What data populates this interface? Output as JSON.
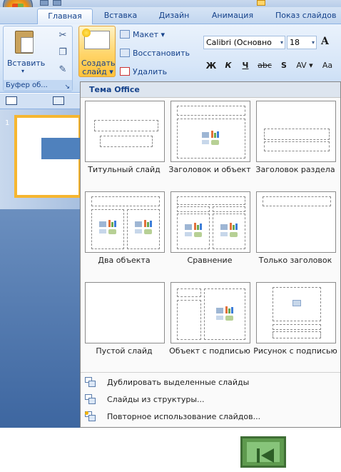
{
  "tabs": [
    "Главная",
    "Вставка",
    "Дизайн",
    "Анимация",
    "Показ слайдов"
  ],
  "ribbon": {
    "paste": "Вставить",
    "clipboard": "Буфер об...",
    "new_slide": "Создать слайд ▾",
    "layout": "Макет ▾",
    "reset": "Восстановить",
    "delete": "Удалить",
    "font_name": "Calibri (Основно",
    "font_size": "18",
    "grow_font": "A",
    "bold": "Ж",
    "italic": "К",
    "underline": "Ч",
    "strike": "abc",
    "shadow": "S",
    "spacing": "AV ▾",
    "case": "Aa"
  },
  "icons": {
    "cut": "✂",
    "copy": "❐",
    "brush": "✎",
    "launcher": "↘",
    "dropdown": "▾"
  },
  "slides": [
    {
      "number": "1"
    }
  ],
  "gallery": {
    "header": "Тема Office",
    "layouts": [
      "Титульный слайд",
      "Заголовок и объект",
      "Заголовок раздела",
      "Два объекта",
      "Сравнение",
      "Только заголовок",
      "Пустой слайд",
      "Объект с подписью",
      "Рисунок с подписью"
    ],
    "menu": [
      "Дублировать выделенные слайды",
      "Слайды из структуры...",
      "Повторное использование слайдов..."
    ]
  }
}
